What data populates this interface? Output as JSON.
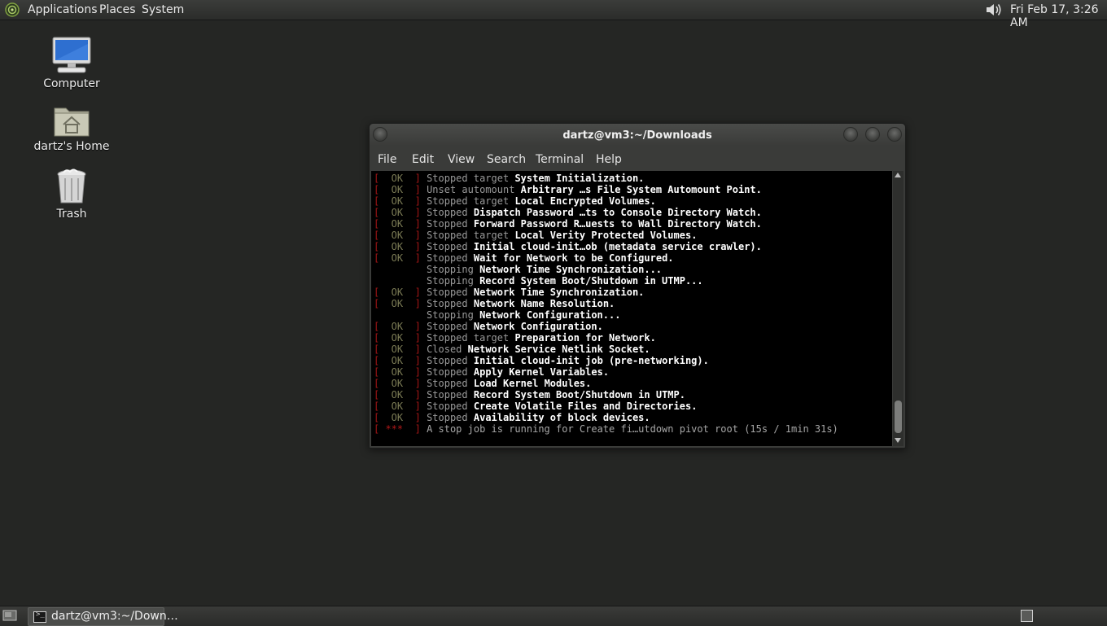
{
  "top_panel": {
    "menus": [
      "Applications",
      "Places",
      "System"
    ],
    "clock": "Fri Feb 17,  3:26 AM",
    "icons": [
      "gnome-menu-icon",
      "volume-icon"
    ]
  },
  "desktop": {
    "icons": [
      {
        "label": "Computer",
        "icon": "computer-icon"
      },
      {
        "label": "dartz's Home",
        "icon": "home-folder-icon"
      },
      {
        "label": "Trash",
        "icon": "trash-icon"
      }
    ]
  },
  "terminal": {
    "title": "dartz@vm3:~/Downloads",
    "menus": [
      "File",
      "Edit",
      "View",
      "Search",
      "Terminal",
      "Help"
    ],
    "lines": [
      {
        "status": "OK",
        "verb": "Stopped target",
        "unit": "System Initialization",
        "end": "."
      },
      {
        "status": "OK",
        "verb": "Unset automount",
        "unit": "Arbitrary …s File System Automount Point",
        "end": "."
      },
      {
        "status": "OK",
        "verb": "Stopped target",
        "unit": "Local Encrypted Volumes",
        "end": "."
      },
      {
        "status": "OK",
        "verb": "Stopped",
        "unit": "Dispatch Password …ts to Console Directory Watch",
        "end": "."
      },
      {
        "status": "OK",
        "verb": "Stopped",
        "unit": "Forward Password R…uests to Wall Directory Watch",
        "end": "."
      },
      {
        "status": "OK",
        "verb": "Stopped target",
        "unit": "Local Verity Protected Volumes",
        "end": "."
      },
      {
        "status": "OK",
        "verb": "Stopped",
        "unit": "Initial cloud-init…ob (metadata service crawler)",
        "end": "."
      },
      {
        "status": "OK",
        "verb": "Stopped",
        "unit": "Wait for Network to be Configured",
        "end": "."
      },
      {
        "status": "",
        "verb": "Stopping",
        "unit": "Network Time Synchronization",
        "end": "..."
      },
      {
        "status": "",
        "verb": "Stopping",
        "unit": "Record System Boot/Shutdown in UTMP",
        "end": "..."
      },
      {
        "status": "OK",
        "verb": "Stopped",
        "unit": "Network Time Synchronization",
        "end": "."
      },
      {
        "status": "OK",
        "verb": "Stopped",
        "unit": "Network Name Resolution",
        "end": "."
      },
      {
        "status": "",
        "verb": "Stopping",
        "unit": "Network Configuration",
        "end": "..."
      },
      {
        "status": "OK",
        "verb": "Stopped",
        "unit": "Network Configuration",
        "end": "."
      },
      {
        "status": "OK",
        "verb": "Stopped target",
        "unit": "Preparation for Network",
        "end": "."
      },
      {
        "status": "OK",
        "verb": "Closed",
        "unit": "Network Service Netlink Socket",
        "end": "."
      },
      {
        "status": "OK",
        "verb": "Stopped",
        "unit": "Initial cloud-init job (pre-networking)",
        "end": "."
      },
      {
        "status": "OK",
        "verb": "Stopped",
        "unit": "Apply Kernel Variables",
        "end": "."
      },
      {
        "status": "OK",
        "verb": "Stopped",
        "unit": "Load Kernel Modules",
        "end": "."
      },
      {
        "status": "OK",
        "verb": "Stopped",
        "unit": "Record System Boot/Shutdown in UTMP",
        "end": "."
      },
      {
        "status": "OK",
        "verb": "Stopped",
        "unit": "Create Volatile Files and Directories",
        "end": "."
      },
      {
        "status": "OK",
        "verb": "Stopped",
        "unit": "Availability of block devices",
        "end": "."
      }
    ],
    "running_line": {
      "status": " ***",
      "text": "A stop job is running for Create fi…utdown pivot root (15s / 1min 31s)"
    },
    "scrollbar_position": 1.0
  },
  "bottom_panel": {
    "task_label": "dartz@vm3:~/Down…",
    "task_icon_prompt": ">_",
    "icons": [
      "show-desktop-icon",
      "terminal-icon",
      "workspace-switcher-icon"
    ]
  }
}
